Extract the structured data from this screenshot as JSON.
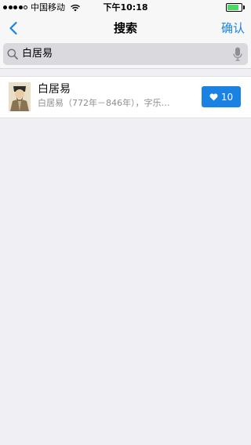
{
  "status_bar": {
    "carrier": "中国移动",
    "time": "下午10:18",
    "battery_level": 0.85,
    "signal_bars": 4,
    "signal_total": 5
  },
  "nav": {
    "title": "搜索",
    "confirm_label": "确认",
    "back_icon": "chevron-left-icon"
  },
  "search": {
    "value": "白居易",
    "icons": [
      "search-icon",
      "microphone-icon"
    ]
  },
  "results": [
    {
      "title": "白居易",
      "subtitle": "白居易（772年－846年），字乐…",
      "like_count": "10",
      "icons": [
        "avatar-portrait",
        "heart-icon"
      ]
    }
  ],
  "colors": {
    "accent": "#1a82e2",
    "background": "#efeff4",
    "battery": "#4cd964"
  }
}
